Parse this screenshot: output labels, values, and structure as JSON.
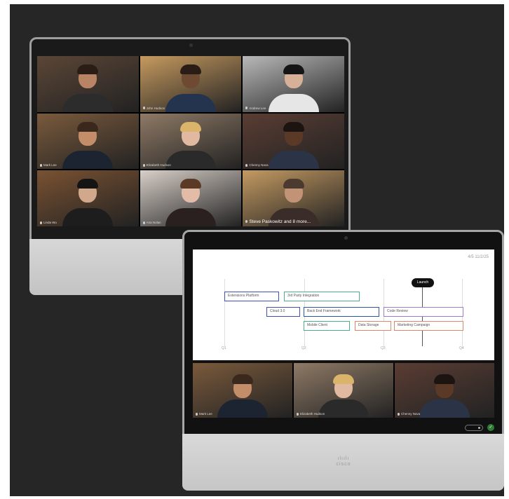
{
  "device_top": {
    "tiles": [
      {
        "name": "",
        "bg": "#5b4636",
        "skin": "#b98466",
        "hair": "#2a1d15",
        "shirt": "#2c2c2c"
      },
      {
        "name": "John Hudson",
        "bg": "#c69a5f",
        "skin": "#6e4a33",
        "hair": "#2a1d15",
        "shirt": "#24344f"
      },
      {
        "name": "Andrew Lee",
        "bg": "#b9b9b9",
        "skin": "#d7b197",
        "hair": "#151515",
        "shirt": "#e6e6e6"
      },
      {
        "name": "Mark Lee",
        "bg": "#7a5a3c",
        "skin": "#c48d6a",
        "hair": "#3a281c",
        "shirt": "#1d2431"
      },
      {
        "name": "Elizabeth Hudson",
        "bg": "#8f7a66",
        "skin": "#e0b9a0",
        "hair": "#d9b46a",
        "shirt": "#2a2a2a"
      },
      {
        "name": "Chenny Nava",
        "bg": "#5a3d33",
        "skin": "#5a3a27",
        "hair": "#1b1410",
        "shirt": "#2b3347"
      },
      {
        "name": "Linda Wu",
        "bg": "#7a5232",
        "skin": "#d2a88c",
        "hair": "#141414",
        "shirt": "#1d1d1d"
      },
      {
        "name": "Ana Nolan",
        "bg": "#d8cfc8",
        "skin": "#e3bca7",
        "hair": "#5a3a27",
        "shirt": "#2a2020"
      },
      {
        "name": "Steve Paskowitz and 8 more...",
        "bg": "#c49a62",
        "skin": "#c29377",
        "hair": "#4a3a30",
        "shirt": "#3a2c28"
      }
    ]
  },
  "device_bottom": {
    "whiteboard": {
      "page_number": "4/5 11/2/25",
      "launch_label": "Launch",
      "axis_labels": [
        "Q1",
        "Q2",
        "Q3",
        "Q4"
      ],
      "bars": [
        {
          "label": "Extensions Platform",
          "color": "#3f51b5"
        },
        {
          "label": "3rd Party Integration",
          "color": "#4caf8a"
        },
        {
          "label": "Cloud 3.0",
          "color": "#3f51b5"
        },
        {
          "label": "Back End Framework",
          "color": "#2a56a8"
        },
        {
          "label": "Code Review",
          "color": "#9c7ad6"
        },
        {
          "label": "Mobile Client",
          "color": "#4caf8a"
        },
        {
          "label": "Data Storage",
          "color": "#e0876a"
        },
        {
          "label": "Marketing Campaign",
          "color": "#e0876a"
        }
      ]
    },
    "strip_tiles": [
      {
        "name": "Mark Lee",
        "bg": "#7a5a3c",
        "skin": "#c48d6a",
        "hair": "#3a281c",
        "shirt": "#1d2431"
      },
      {
        "name": "Elizabeth Hudson",
        "bg": "#8f7a66",
        "skin": "#e0b9a0",
        "hair": "#d9b46a",
        "shirt": "#2a2a2a"
      },
      {
        "name": "Chenny Nava",
        "bg": "#5a3d33",
        "skin": "#5a3a27",
        "hair": "#1b1410",
        "shirt": "#2b3347"
      }
    ],
    "brand_logo": "cisco"
  }
}
